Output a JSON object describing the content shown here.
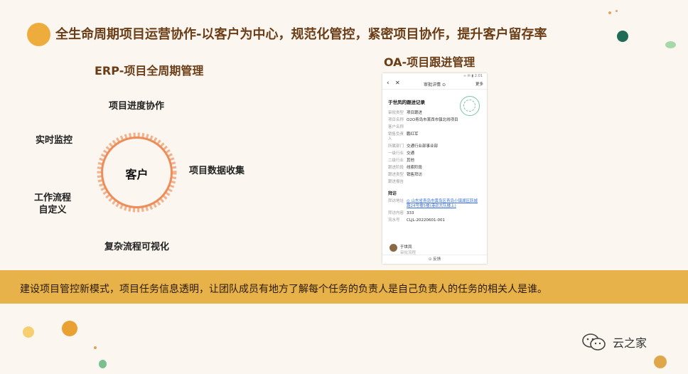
{
  "title": "全生命周期项目运营协作-以客户为中心，规范化管控，紧密项目协作，提升客户留存率",
  "erp": {
    "heading": "ERP-项目全周期管理",
    "center": "客户",
    "items": {
      "progress": "项目进度协作",
      "monitor": "实时监控",
      "data": "项目数据收集",
      "workflow_line1": "工作流程",
      "workflow_line2": "自定义",
      "visual": "复杂流程可视化"
    }
  },
  "oa": {
    "heading": "OA-项目跟进管理",
    "phone": {
      "status": "∞ ✉ ▮ 2:01",
      "back_icon": "chevron-left-icon",
      "close_icon": "close-icon",
      "nav_title": "审批详情 ⊙",
      "more": "更多",
      "record_title": "于世凤的跟进记录",
      "fields": [
        {
          "k": "审批类型",
          "v": "项目跟进"
        },
        {
          "k": "项目名称",
          "v": "O2O青岛市莱西市镇北线项目"
        },
        {
          "k": "客户名称",
          "v": ""
        },
        {
          "k": "销售负责人",
          "v": "鹏红军"
        },
        {
          "k": "所属部门",
          "v": "交通行业部事业部"
        },
        {
          "k": "一级行业",
          "v": "交通"
        },
        {
          "k": "二级行业",
          "v": "其他"
        },
        {
          "k": "跟进阶段",
          "v": "线索阶段"
        },
        {
          "k": "跟进类型",
          "v": "销售拜访"
        },
        {
          "k": "跟进报告",
          "v": ""
        }
      ],
      "sub_title": "拜访",
      "visit_fields": [
        {
          "k": "拜访地址",
          "v": "◎ 山东省青岛市黄岛区青岛小镇湖区跃城路24号楼5楼(港劲大队楼上)",
          "link": true
        },
        {
          "k": "拜访内容",
          "v": "333",
          "link": false
        },
        {
          "k": "流水号",
          "v": "CLJL-20220601-001",
          "link": false
        }
      ],
      "user_name": "于世凤",
      "user_note": "审批流程",
      "feedback": "⊙ 反馈"
    }
  },
  "banner": "建设项目管控新模式，项目任务信息透明，让团队成员有地方了解每个任务的负责人是自己负责人的任务的相关人是谁。",
  "brand": {
    "icon": "wechat-icon",
    "text": "云之家"
  },
  "colors": {
    "accent": "#e9a83a",
    "banner": "#e7b24a",
    "green": "#2f7a5e",
    "title": "#6a3d16"
  }
}
